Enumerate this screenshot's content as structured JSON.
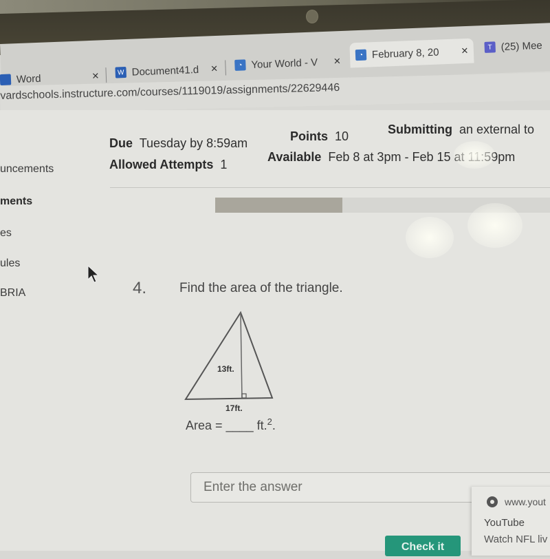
{
  "browser": {
    "tabs": [
      {
        "label": "Word",
        "icon": "word-icon",
        "active": false
      },
      {
        "label": "Document41.d",
        "icon": "word-icon",
        "active": false
      },
      {
        "label": "Your World - V",
        "icon": "app-icon",
        "active": false
      },
      {
        "label": "February 8, 20",
        "icon": "app-icon",
        "active": true
      },
      {
        "label": "(25) Mee",
        "icon": "teams-icon",
        "active": false
      }
    ],
    "close_glyph": "×",
    "url": "vardschools.instructure.com/courses/1119019/assignments/22629446"
  },
  "sidebar": {
    "items": [
      {
        "label": "uncements"
      },
      {
        "label": "ments",
        "active": true
      },
      {
        "label": "es"
      },
      {
        "label": "ules"
      },
      {
        "label": "BRIA"
      }
    ]
  },
  "assignment": {
    "due_label": "Due",
    "due_value": "Tuesday by 8:59am",
    "points_label": "Points",
    "points_value": "10",
    "submitting_label": "Submitting",
    "submitting_value": "an external to",
    "attempts_label": "Allowed Attempts",
    "attempts_value": "1",
    "available_label": "Available",
    "available_value": "Feb 8 at 3pm - Feb 15 at 11:59pm",
    "progress_percent": 38
  },
  "question": {
    "number": "4.",
    "prompt": "Find the area of the triangle.",
    "height_label": "13ft.",
    "base_label": "17ft.",
    "area_prefix": "Area =",
    "area_blank": "____",
    "area_unit": "ft.",
    "area_exp": "2",
    "area_suffix": ".",
    "answer_placeholder": "Enter the answer",
    "check_button": "Check it"
  },
  "notification": {
    "site": "www.yout",
    "title": "YouTube",
    "body": "Watch NFL liv"
  }
}
